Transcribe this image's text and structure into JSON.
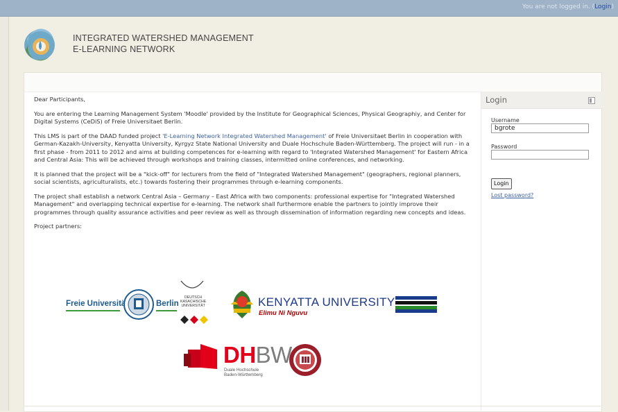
{
  "topbar": {
    "login_status_prefix": "You are not logged in. (",
    "login_link": "Login",
    "login_status_suffix": ")"
  },
  "header": {
    "title_line1": "INTEGRATED WATERSHED MANAGEMENT",
    "title_line2": "E-LEARNING NETWORK"
  },
  "main": {
    "greeting": "Dear Participants,",
    "p1": "You are entering the Learning Management System 'Moodle' provided by the Institute for Geographical Sciences, Physical Geographiy, and Center for Digital Systems (CeDiS) of Freie Universitaet Berlin.",
    "p2_before": "This LMS is part of the DAAD funded project ",
    "p2_link": "'E-Learning Network Integrated Watershed Management'",
    "p2_after": " of Freie Universitaet Berlin in cooperation with German-Kazakh-University, Kenyatta University, Kyrgyz State National University and Duale Hochschule Baden-Württemberg. The project will run - in a first phase - from 2011 to 2012 and aims at building competences for e-learning with regard to 'Integrated Watershed Management' for Eastern Africa and Central Asia: This will be achieved through workshops and training classes, intermitted online conferences, and networking.",
    "p3": "It is planned that the project will be a \"kick-off\" for lecturers from the field of \"Integrated Watershed Management\" (geographers, regional planners, social scientists, agriculturalists, etc.) towards fostering their programmes through e-learning components.",
    "p4": "The project shall establish a network Central Asia – Germany – East Africa with two components: professional expertise for \"Integrated Watershed Management\" and overlapping technical expertise for e-learning. The network shall furthermore enable the partners to jointly improve their programmes through quality assurance activities and peer review as well as through dissemination of information regarding new concepts and ideas.",
    "partners_label": "Project partners:"
  },
  "partners": {
    "fu_left": "Freie Universität",
    "fu_right": "Berlin",
    "dk_text": "DEUTSCH\nKASACHISCHE\nUNIVERSITÄT",
    "ku_title": "KENYATTA UNIVERSITY",
    "ku_motto": "Elimu Ni Nguvu",
    "dhbw_dh": "DH",
    "dhbw_bw": "BW",
    "dhbw_sub": "Duale Hochschule\nBaden-Württemberg"
  },
  "login_block": {
    "title": "Login",
    "username_label": "Username",
    "username_value": "bgrote",
    "password_label": "Password",
    "password_value": "",
    "login_button": "Login",
    "lost_password": "Lost password?"
  },
  "colors": {
    "topbar": "#9fb3c8",
    "background": "#f1eee3",
    "link": "#3b5fa0",
    "accent_red": "#e2001a",
    "kenyatta_blue": "#1d3a8a"
  },
  "icons": [
    "watershed-logo",
    "fu-seal",
    "dku-logo",
    "kenyatta-crest",
    "kenyatta-flag",
    "dhbw-logo",
    "kyrgyz-seal",
    "block-toggle-icon"
  ]
}
